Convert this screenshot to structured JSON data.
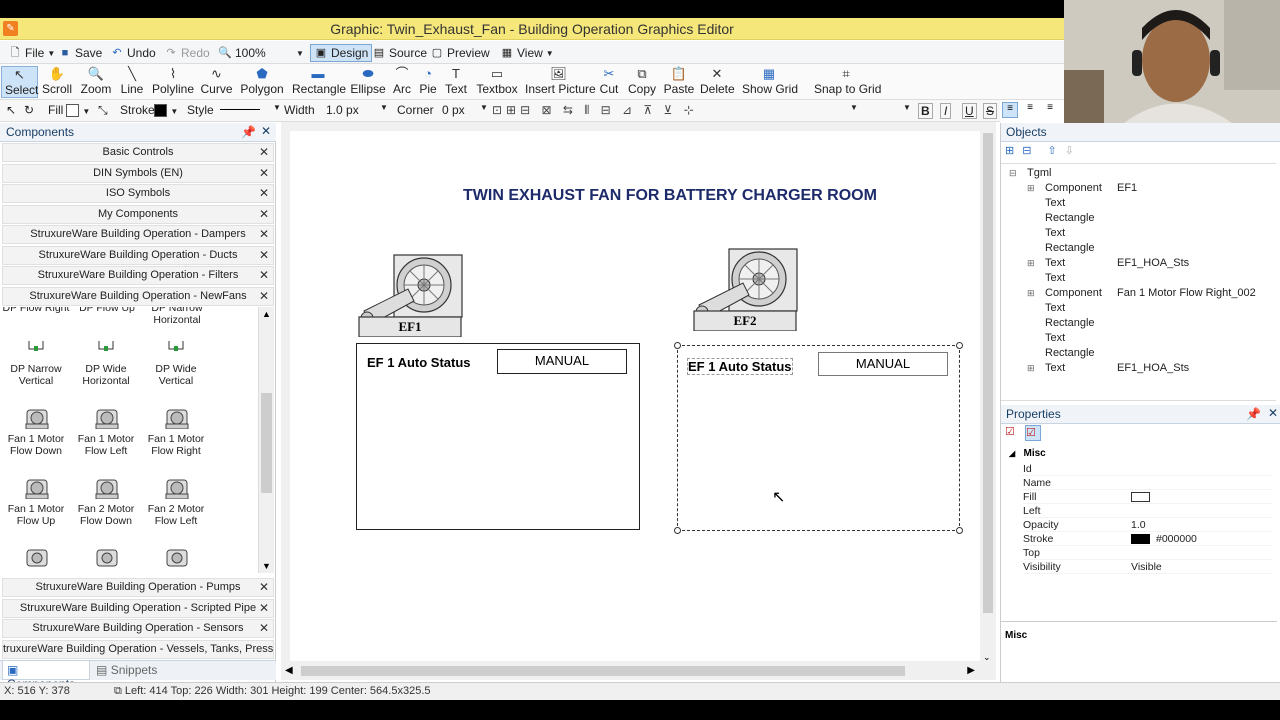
{
  "window": {
    "title": "Graphic: Twin_Exhaust_Fan - Building Operation Graphics Editor"
  },
  "menu": {
    "file": "File",
    "save": "Save",
    "undo": "Undo",
    "redo": "Redo",
    "zoom": "100%",
    "design": "Design",
    "source": "Source",
    "preview": "Preview",
    "view": "View"
  },
  "ribbon": [
    "Select",
    "Scroll",
    "Zoom",
    "Line",
    "Polyline",
    "Curve",
    "Polygon",
    "Rectangle",
    "Ellipse",
    "Arc",
    "Pie",
    "Text",
    "Textbox",
    "Insert Picture",
    "Cut",
    "Copy",
    "Paste",
    "Delete",
    "Show Grid",
    "Snap to Grid"
  ],
  "format": {
    "fill_label": "Fill",
    "stroke_label": "Stroke",
    "style_label": "Style",
    "width_label": "Width",
    "width_value": "1.0 px",
    "corner_label": "Corner",
    "corner_value": "0 px"
  },
  "components": {
    "title": "Components",
    "top_sections": [
      "Basic Controls",
      "DIN Symbols (EN)",
      "ISO Symbols",
      "My Components",
      "StruxureWare Building Operation - Dampers",
      "StruxureWare Building Operation - Ducts",
      "StruxureWare Building Operation - Filters",
      "StruxureWare Building Operation - NewFans"
    ],
    "palette_top_clip": [
      "DP Flow Right",
      "DP Flow Up",
      "DP Narrow Horizontal"
    ],
    "palette": [
      [
        "DP Narrow",
        "Vertical"
      ],
      [
        "DP Wide",
        "Horizontal"
      ],
      [
        "DP Wide",
        "Vertical"
      ],
      [
        "Fan 1 Motor",
        "Flow Down"
      ],
      [
        "Fan 1 Motor",
        "Flow Left"
      ],
      [
        "Fan 1 Motor",
        "Flow Right"
      ],
      [
        "Fan 1 Motor",
        "Flow Up"
      ],
      [
        "Fan 2 Motor",
        "Flow Down"
      ],
      [
        "Fan 2 Motor",
        "Flow Left"
      ]
    ],
    "bottom_sections": [
      "StruxureWare Building Operation - Pumps",
      "StruxureWare Building Operation - Scripted Pipe",
      "StruxureWare Building Operation - Sensors",
      "truxureWare Building Operation - Vessels, Tanks, Press Units"
    ],
    "tabs": [
      "Components",
      "Snippets"
    ]
  },
  "canvas": {
    "title": "TWIN EXHAUST FAN FOR BATTERY CHARGER ROOM",
    "fan1_label": "EF1",
    "fan2_label": "EF2",
    "box1_label": "EF 1 Auto Status",
    "box1_value": "MANUAL",
    "box2_label": "EF 1 Auto Status",
    "box2_value": "MANUAL"
  },
  "objects": {
    "title": "Objects",
    "tree": [
      {
        "type": "Tgml",
        "name": ""
      },
      {
        "type": "Component",
        "name": "EF1"
      },
      {
        "type": "Text",
        "name": ""
      },
      {
        "type": "Rectangle",
        "name": ""
      },
      {
        "type": "Text",
        "name": ""
      },
      {
        "type": "Rectangle",
        "name": ""
      },
      {
        "type": "Text",
        "name": "EF1_HOA_Sts"
      },
      {
        "type": "Text",
        "name": ""
      },
      {
        "type": "Component",
        "name": "Fan 1 Motor Flow Right_002"
      },
      {
        "type": "Text",
        "name": ""
      },
      {
        "type": "Rectangle",
        "name": ""
      },
      {
        "type": "Text",
        "name": ""
      },
      {
        "type": "Rectangle",
        "name": ""
      },
      {
        "type": "Text",
        "name": "EF1_HOA_Sts"
      }
    ]
  },
  "properties": {
    "title": "Properties",
    "group": "Misc",
    "rows": [
      [
        "Id",
        ""
      ],
      [
        "Name",
        ""
      ],
      [
        "Fill",
        ""
      ],
      [
        "Left",
        ""
      ],
      [
        "Opacity",
        "1.0"
      ],
      [
        "Stroke",
        "#000000"
      ],
      [
        "Top",
        ""
      ],
      [
        "Visibility",
        "Visible"
      ]
    ],
    "footer": "Misc"
  },
  "status": {
    "cursor": "X: 516  Y: 378",
    "geometry": "Left: 414  Top: 226  Width: 301  Height: 199  Center: 564.5x325.5"
  }
}
